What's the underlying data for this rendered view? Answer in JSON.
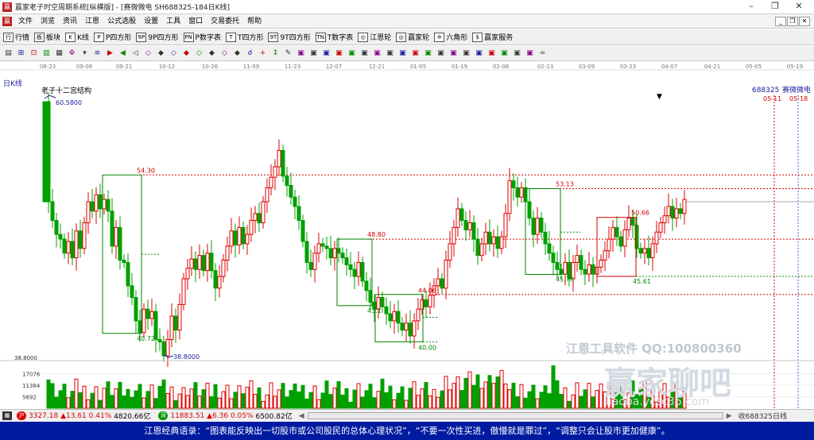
{
  "window": {
    "title": "赢家老子时空周期系统[纵横版] - [赛微微电  SH688325-184日K线]",
    "minimize": "–",
    "maximize": "❐",
    "close": "✕"
  },
  "menu": [
    "文件",
    "浏览",
    "资讯",
    "江恩",
    "公式选股",
    "设置",
    "工具",
    "窗口",
    "交易委托",
    "帮助"
  ],
  "toolbar1": [
    {
      "icon": "行",
      "label": "行情"
    },
    {
      "icon": "板",
      "label": "板块"
    },
    {
      "icon": "K",
      "label": "K线"
    },
    {
      "icon": "P",
      "label": "P四方形"
    },
    {
      "icon": "9P",
      "label": "9P四方形"
    },
    {
      "icon": "PN",
      "label": "P数字表"
    },
    {
      "icon": "T",
      "label": "T四方形"
    },
    {
      "icon": "9T",
      "label": "9T四方形"
    },
    {
      "icon": "TN",
      "label": "T数字表"
    },
    {
      "icon": "◎",
      "label": "江恩轮"
    },
    {
      "icon": "◎",
      "label": "赢家轮"
    },
    {
      "icon": "✡",
      "label": "六角形"
    },
    {
      "icon": "$",
      "label": "赢家服务"
    }
  ],
  "toolbar2_icons": [
    "▤",
    "⊞",
    "⊡",
    "▥",
    "▦",
    "Φ",
    "▾",
    "≡",
    "▶",
    "◀",
    "◁",
    "◇",
    "◆",
    "◇",
    "◆",
    "◇",
    "◆",
    "◇",
    "◆",
    "☌",
    "+",
    "↕",
    "✎",
    "▣",
    "▣",
    "▣",
    "▣",
    "▣",
    "▣",
    "▣",
    "▣",
    "▣",
    "▣",
    "▣",
    "▣",
    "▣",
    "▣",
    "▣",
    "▣",
    "▣",
    "▣",
    "▣",
    "∞"
  ],
  "chart": {
    "period_label": "日K线",
    "indicator_name": "老子十二宫结构",
    "stock_code": "688325",
    "stock_name": "赛微微电",
    "right_dates": [
      "05-11",
      "05-18"
    ],
    "date_ticks": [
      "08-23",
      "09-06",
      "09-21",
      "10-12",
      "10-26",
      "11-09",
      "11-23",
      "12-07",
      "12-21",
      "01-05",
      "01-19",
      "02-08",
      "02-23",
      "03-09",
      "03-23",
      "04-07",
      "04-21",
      "05-05",
      "05-19"
    ],
    "price_labels": {
      "high": "60.5800",
      "low": "38.8000",
      "axis_low": "38.8000"
    },
    "box_labels": [
      "54.30",
      "40.72",
      "48.80",
      "43.1",
      "44.06",
      "40.00",
      "53.13",
      "45.78",
      "50.66",
      "45.61"
    ],
    "volume_ticks": [
      "17076",
      "11384",
      "5692"
    ],
    "colors": {
      "up": "#e00000",
      "down": "#00a000",
      "box": "#008000",
      "box_red": "#d00000",
      "dash": "#d00000"
    }
  },
  "watermark": {
    "line1": "江恩工具软件  QQ:100800360",
    "line2": "赢家聊吧",
    "line3": "liaoba.ycsc36.com"
  },
  "status": {
    "sh_value": "3327.18",
    "sh_change": "▲13.61",
    "sh_pct": "0.41%",
    "sh_amount": "4820.66亿",
    "sz_value": "11883.51",
    "sz_change": "▲6.36",
    "sz_pct": "0.05%",
    "sz_amount": "6500.82亿",
    "right_text": "收688325日线"
  },
  "quote": "江恩经典语录：“图表能反映出一切股市或公司股民的总体心理状况”，“不要一次性买进，傲慢就是罪过”，“调整只会让股市更加健康”。"
}
